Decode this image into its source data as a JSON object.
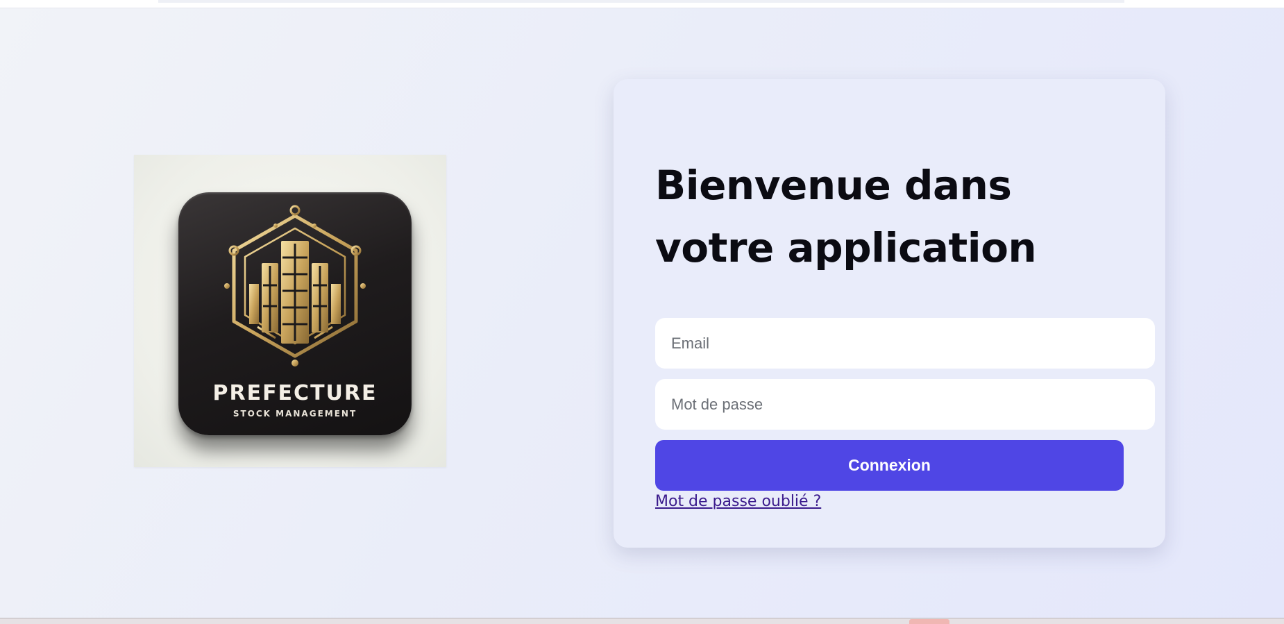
{
  "logo": {
    "title": "PREFECTURE",
    "subtitle": "STOCK MANAGEMENT"
  },
  "login": {
    "heading": "Bienvenue dans votre application",
    "email_placeholder": "Email",
    "password_placeholder": "Mot de passe",
    "submit_label": "Connexion",
    "forgot_link": "Mot de passe oublié ?"
  },
  "colors": {
    "accent": "#4f46e5",
    "card_background": "#e9ecfa",
    "link": "#3a1a8c"
  }
}
